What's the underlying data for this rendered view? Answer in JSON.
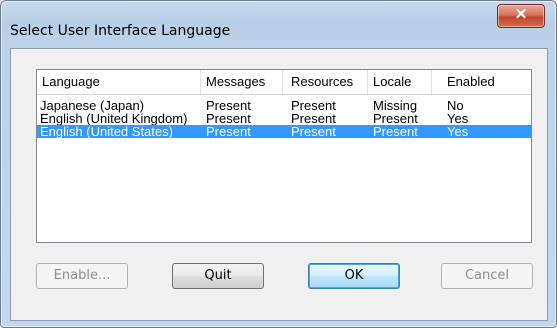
{
  "dialog": {
    "title": "Select User Interface Language",
    "close_icon": "close-x-icon"
  },
  "listview": {
    "columns": [
      "Language",
      "Messages",
      "Resources",
      "Locale",
      "Enabled"
    ],
    "rows": [
      {
        "language": "Japanese (Japan)",
        "messages": "Present",
        "resources": "Present",
        "locale": "Missing",
        "enabled": "No",
        "selected": false
      },
      {
        "language": "English (United Kingdom)",
        "messages": "Present",
        "resources": "Present",
        "locale": "Present",
        "enabled": "Yes",
        "selected": false
      },
      {
        "language": "English (United States)",
        "messages": "Present",
        "resources": "Present",
        "locale": "Present",
        "enabled": "Yes",
        "selected": true
      }
    ]
  },
  "buttons": {
    "enable": "Enable...",
    "quit": "Quit",
    "ok": "OK",
    "cancel": "Cancel"
  },
  "colors": {
    "selection": "#3399ff",
    "close_button": "#c4452d"
  }
}
